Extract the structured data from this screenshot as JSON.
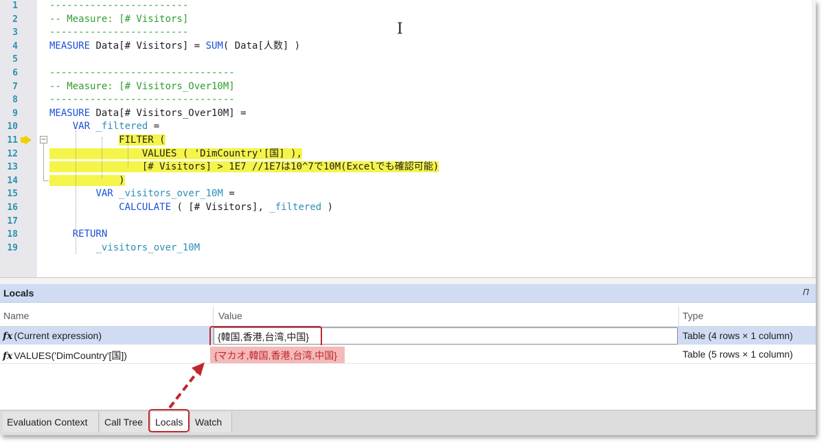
{
  "editor": {
    "line_numbers": [
      "1",
      "2",
      "3",
      "4",
      "5",
      "6",
      "7",
      "8",
      "9",
      "10",
      "11",
      "12",
      "13",
      "14",
      "15",
      "16",
      "17",
      "18",
      "19"
    ],
    "lines": [
      [
        {
          "t": "------------------------",
          "c": "cm"
        }
      ],
      [
        {
          "t": "-- Measure: [# Visitors]",
          "c": "cm"
        }
      ],
      [
        {
          "t": "------------------------",
          "c": "cm"
        }
      ],
      [
        {
          "t": "MEASURE",
          "c": "kw"
        },
        {
          "t": " Data[# Visitors] = ",
          "c": ""
        },
        {
          "t": "SUM",
          "c": "fn"
        },
        {
          "t": "( Data[人数] )",
          "c": ""
        }
      ],
      [],
      [
        {
          "t": "--------------------------------",
          "c": "cm"
        }
      ],
      [
        {
          "t": "-- Measure: [# Visitors_Over10M]",
          "c": "cm"
        }
      ],
      [
        {
          "t": "--------------------------------",
          "c": "cm"
        }
      ],
      [
        {
          "t": "MEASURE",
          "c": "kw"
        },
        {
          "t": " Data[# Visitors_Over10M] =",
          "c": ""
        }
      ],
      [
        {
          "t": "    ",
          "c": ""
        },
        {
          "t": "VAR",
          "c": "kw"
        },
        {
          "t": " ",
          "c": ""
        },
        {
          "t": "_filtered",
          "c": "vr"
        },
        {
          "t": " =",
          "c": ""
        }
      ],
      [
        {
          "t": "            ",
          "c": ""
        },
        {
          "t": "FILTER (",
          "c": "hl"
        }
      ],
      [
        {
          "t": "                VALUES ( ",
          "c": "hl"
        },
        {
          "t": "'DimCountry'[国] ),",
          "c": "hl"
        }
      ],
      [
        {
          "t": "                [# Visitors] > 1E7 //1E7は10^7で10M(Excelでも確認可能)",
          "c": "hl"
        }
      ],
      [
        {
          "t": "            )",
          "c": "hl"
        }
      ],
      [
        {
          "t": "        ",
          "c": ""
        },
        {
          "t": "VAR",
          "c": "kw"
        },
        {
          "t": " ",
          "c": ""
        },
        {
          "t": "_visitors_over_10M",
          "c": "vr"
        },
        {
          "t": " =",
          "c": ""
        }
      ],
      [
        {
          "t": "            ",
          "c": ""
        },
        {
          "t": "CALCULATE",
          "c": "fn"
        },
        {
          "t": " ( [# Visitors], ",
          "c": ""
        },
        {
          "t": "_filtered",
          "c": "vr"
        },
        {
          "t": " )",
          "c": ""
        }
      ],
      [],
      [
        {
          "t": "    ",
          "c": ""
        },
        {
          "t": "RETURN",
          "c": "kw"
        }
      ],
      [
        {
          "t": "        ",
          "c": ""
        },
        {
          "t": "_visitors_over_10M",
          "c": "vr"
        }
      ]
    ]
  },
  "locals": {
    "title": "Locals",
    "pin_icon": "pin-icon",
    "columns": {
      "name": "Name",
      "value": "Value",
      "type": "Type"
    },
    "rows": [
      {
        "icon": "fx",
        "name": "(Current expression)",
        "value": "{韓国,香港,台湾,中国}",
        "type": "Table (4 rows × 1 column)"
      },
      {
        "icon": "fx",
        "name": "VALUES('DimCountry'[国])",
        "value": "{マカオ,韓国,香港,台湾,中国}",
        "type": "Table (5 rows × 1 column)"
      }
    ]
  },
  "tabs": [
    {
      "label": "Evaluation Context"
    },
    {
      "label": "Call Tree"
    },
    {
      "label": "Locals"
    },
    {
      "label": "Watch"
    }
  ],
  "colors": {
    "comment": "#2e9e2e",
    "keyword": "#1a4fd6",
    "highlight": "#f4f44a",
    "selection": "#cfdcf3",
    "annotation_red": "#c0272d"
  }
}
